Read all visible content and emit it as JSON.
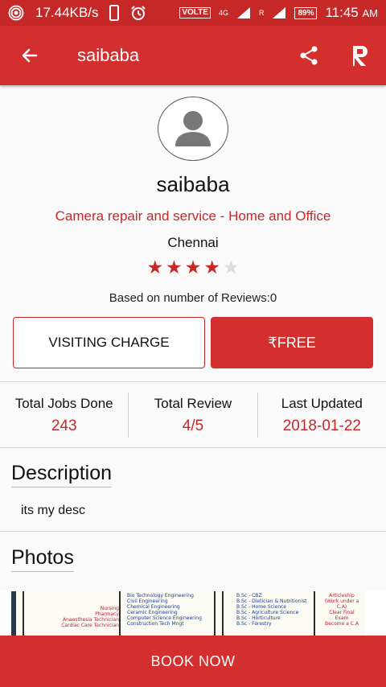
{
  "status_bar": {
    "speed": "17.44KB/s",
    "volte": "VOLTE",
    "network": "4G",
    "roaming": "R",
    "battery": "89%",
    "time": "11:45",
    "ampm": "AM"
  },
  "appbar": {
    "title": "saibaba",
    "logo_letter": "R",
    "icons": [
      "back-arrow-icon",
      "share-icon",
      "brand-logo-icon"
    ]
  },
  "profile": {
    "name": "saibaba",
    "category": "Camera repair and service - Home and Office",
    "city": "Chennai",
    "rating": 4,
    "rating_max": 5,
    "reviews_note": "Based on number of Reviews:0"
  },
  "charge": {
    "label": "VISITING CHARGE",
    "value": "₹FREE"
  },
  "stats": [
    {
      "label": "Total Jobs Done",
      "value": "243"
    },
    {
      "label": "Total Review",
      "value": "4/5"
    },
    {
      "label": "Last Updated",
      "value": "2018-01-22"
    }
  ],
  "description": {
    "title": "Description",
    "text": "its my desc"
  },
  "photos": {
    "title": "Photos",
    "image_text": {
      "col1": [
        "Nursing",
        "Pharmacy",
        "Anaesthesia Technician",
        "Cardiac Care Technician"
      ],
      "col2": [
        "Bio Technology Engineering",
        "Civil Engineering",
        "Chemical Engineering",
        "Ceramic Engineering",
        "Computer Science Engineering",
        "Construction Tech Mngt"
      ],
      "col3": [
        "B.Sc - CBZ",
        "B.Sc - Dietician & Nutritionist",
        "B.Sc - Home Science",
        "B.Sc - Agriculture Science",
        "B.Sc - Horticulture",
        "B.Sc - Forestry"
      ],
      "col4": [
        "Articleship",
        "(Work under a C.A)",
        "Clear Final Exam",
        "Become a C.A"
      ]
    }
  },
  "book_now": "BOOK NOW",
  "colors": {
    "primary": "#d32f2f",
    "status_bar": "#c62828",
    "accent_text": "#c62828",
    "star_off": "#dcdcdc"
  }
}
